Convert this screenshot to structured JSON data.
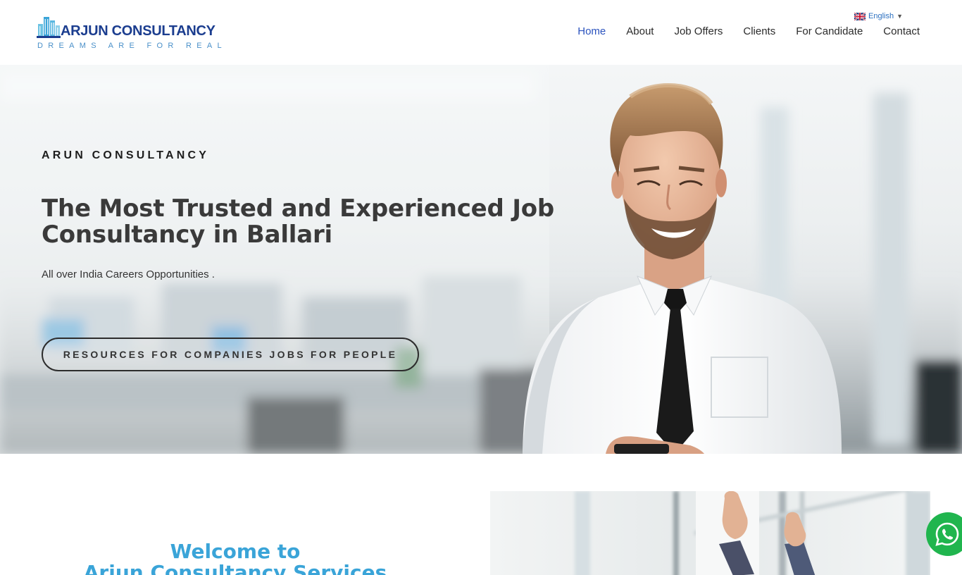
{
  "header": {
    "logo": {
      "name": "ARJUN CONSULTANCY",
      "tagline": "DREAMS ARE FOR REAL"
    },
    "language": {
      "label": "English",
      "flag_icon": "uk-flag-icon"
    },
    "nav": [
      {
        "label": "Home",
        "active": true
      },
      {
        "label": "About",
        "active": false
      },
      {
        "label": "Job Offers",
        "active": false
      },
      {
        "label": "Clients",
        "active": false
      },
      {
        "label": "For Candidate",
        "active": false
      },
      {
        "label": "Contact",
        "active": false
      }
    ]
  },
  "hero": {
    "eyebrow": "ARUN CONSULTANCY",
    "headline": "The Most Trusted and Experienced Job Consultancy in Ballari",
    "subline": "All over India Careers Opportunities  .",
    "cta_label": "RESOURCES FOR COMPANIES JOBS FOR PEOPLE"
  },
  "welcome": {
    "title_line1": "Welcome to",
    "title_line2": "Arjun Consultancy Services"
  },
  "floating": {
    "whatsapp_icon": "whatsapp-icon"
  },
  "colors": {
    "nav_active": "#2a52be",
    "logo_blue": "#1b3d8f",
    "tagline_blue": "#4a90c9",
    "welcome_title": "#3aa4d8",
    "whatsapp_green": "#20b54e"
  }
}
